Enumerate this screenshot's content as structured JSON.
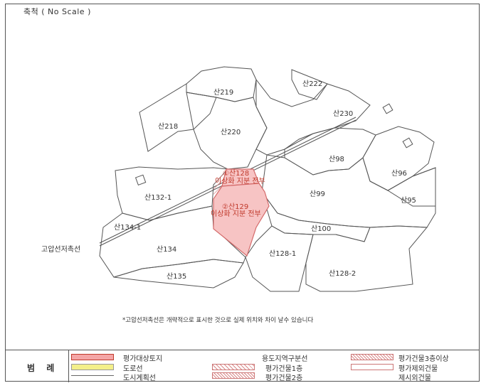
{
  "map": {
    "scale_text": "축척 ( No Scale )",
    "note": "*고압선저촉선은 개략적으로 표시한 것으로 실제 위치와 차이 날수 있습니다",
    "hv_line_label": "고압선저촉선",
    "lots": {
      "san219": "산219",
      "san222": "산222",
      "san230": "산230",
      "san218": "산218",
      "san220": "산220",
      "san98": "산98",
      "san96": "산96",
      "san132_1": "산132-1",
      "san99": "산99",
      "san95": "산95",
      "san134_1": "산134-1",
      "san100": "산100",
      "san134": "산134",
      "san128_1": "산128-1",
      "san135": "산135",
      "san128_2": "산128-2"
    },
    "subject1_line1": "①산128",
    "subject1_line2": "이상화 지분 전부",
    "subject2_line1": "②산129",
    "subject2_line2": "이상화 지분 전부",
    "colors": {
      "subject_fill": "#f7c4c4",
      "subject_stroke": "#d46a6a",
      "line": "#555555"
    }
  },
  "legend": {
    "title": "범 례",
    "items": {
      "subject_land": "평가대상토지",
      "road": "도로선",
      "city_plan": "도시계획선",
      "zone_boundary": "용도지역구분선",
      "bldg_1f": "평가건물1층",
      "bldg_2f": "평가건물2층",
      "bldg_3f": "평가건물3층이상",
      "excluded_bldg": "평가제외건물",
      "non_subject_bldg": "제시외건물"
    },
    "colors": {
      "subject": "#f4a6a6",
      "road": "#f3ef8a",
      "hatch": "#d98a8a"
    }
  }
}
